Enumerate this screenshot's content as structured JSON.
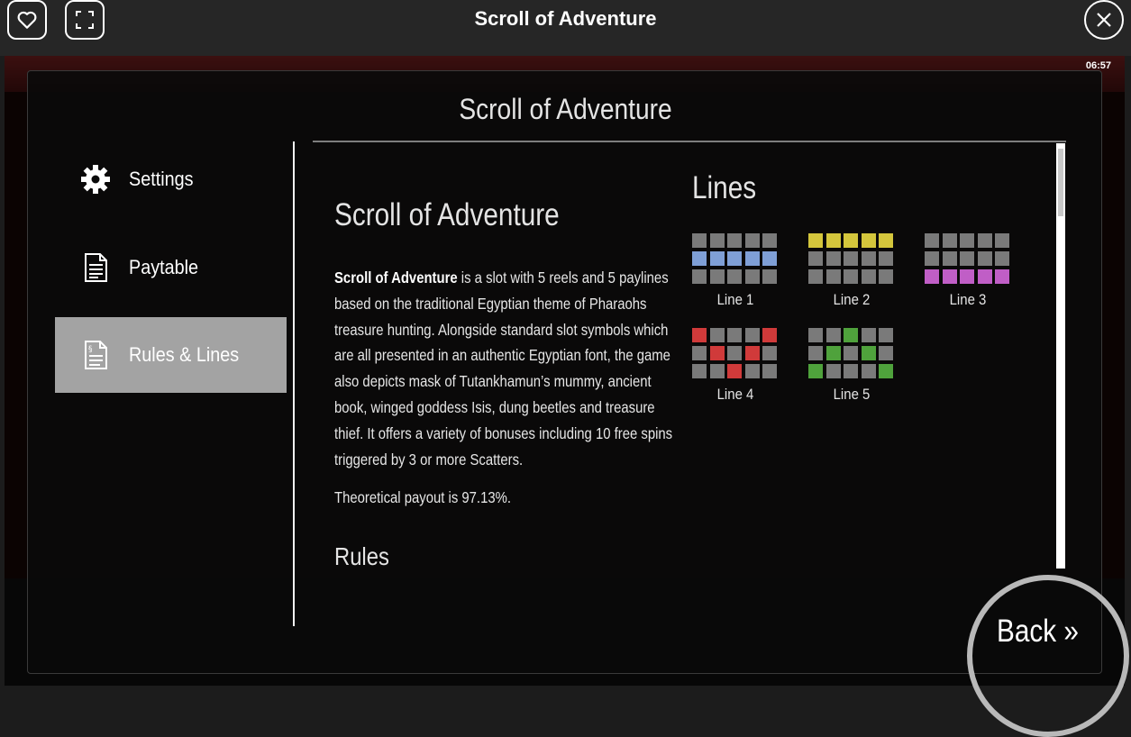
{
  "topbar": {
    "title": "Scroll of Adventure",
    "favorite_icon": "heart-icon",
    "fullscreen_icon": "fullscreen-icon",
    "close_icon": "close-icon"
  },
  "game": {
    "clock": "06:57"
  },
  "modal": {
    "title": "Scroll of Adventure",
    "menu": [
      {
        "label": "Settings",
        "icon": "gear-icon",
        "active": false
      },
      {
        "label": "Paytable",
        "icon": "document-icon",
        "active": false
      },
      {
        "label": "Rules & Lines",
        "icon": "rules-document-icon",
        "active": true
      }
    ],
    "content": {
      "heading": "Scroll of Adventure",
      "description_bold": "Scroll of Adventure",
      "description_rest": " is a slot with 5 reels and 5 paylines based on the traditional Egyptian theme of Pharaohs treasure hunting. Alongside standard slot symbols which are all presented in an authentic Egyptian font, the game also depicts mask of Tutankhamun’s mummy, ancient book, winged goddess Isis, dung beetles and treasure thief. It offers a variety of bonuses including 10 free spins triggered by 3 or more Scatters.",
      "payout": "Theoretical payout is 97.13%.",
      "rules_heading": "Rules"
    },
    "lines": {
      "heading": "Lines",
      "items": [
        {
          "label": "Line 1",
          "color": "#7f9fd6",
          "rows": [
            1,
            1,
            1,
            1,
            1
          ]
        },
        {
          "label": "Line 2",
          "color": "#d4c63c",
          "rows": [
            0,
            0,
            0,
            0,
            0
          ]
        },
        {
          "label": "Line 3",
          "color": "#c05ec6",
          "rows": [
            2,
            2,
            2,
            2,
            2
          ]
        },
        {
          "label": "Line 4",
          "color": "#d03a3a",
          "rows": [
            0,
            1,
            2,
            1,
            0
          ]
        },
        {
          "label": "Line 5",
          "color": "#4fa23c",
          "rows": [
            2,
            1,
            0,
            1,
            2
          ]
        }
      ]
    },
    "back_label": "Back »"
  },
  "colors": {
    "accent_active": "#a3a3a3",
    "text": "#e4e4e4"
  }
}
